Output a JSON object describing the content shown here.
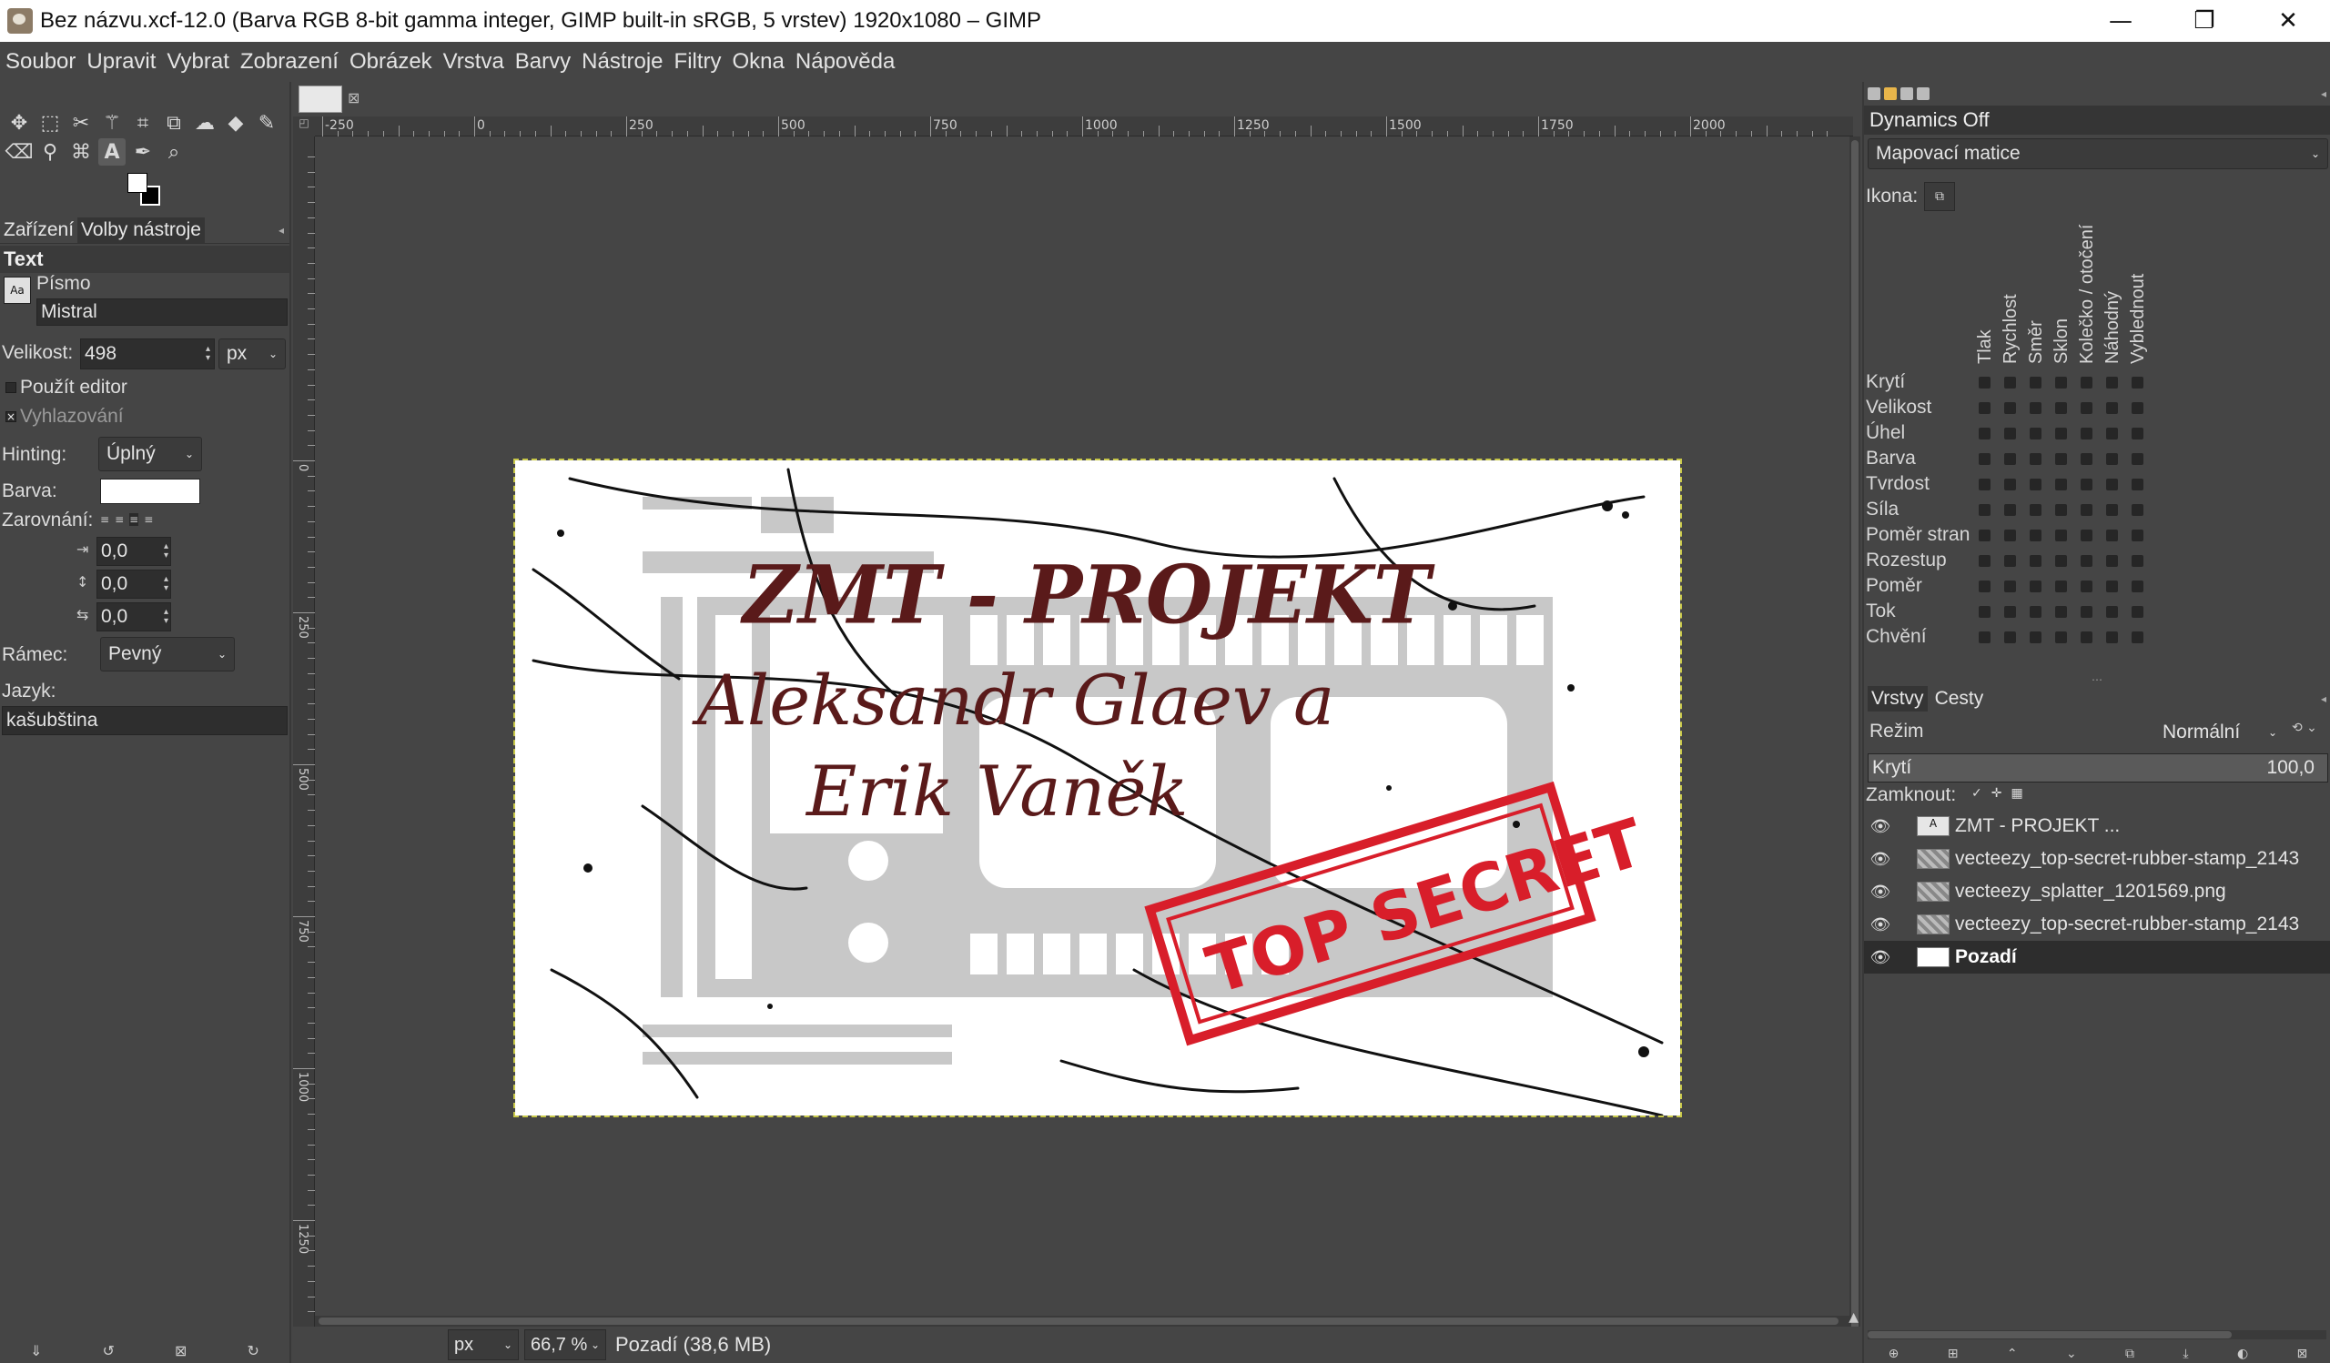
{
  "window": {
    "title": "Bez názvu.xcf-12.0 (Barva RGB 8-bit gamma integer, GIMP built-in sRGB, 5 vrstev) 1920x1080 – GIMP",
    "minimize": "—",
    "maximize": "❐",
    "close": "✕"
  },
  "menubar": [
    "Soubor",
    "Upravit",
    "Vybrat",
    "Zobrazení",
    "Obrázek",
    "Vrstva",
    "Barvy",
    "Nástroje",
    "Filtry",
    "Okna",
    "Nápověda"
  ],
  "toolbox": {
    "row1_icons": [
      "move-icon",
      "rect-select-icon",
      "free-select-icon",
      "fuzzy-select-icon",
      "crop-icon",
      "transform-icon",
      "warp-icon",
      "bucket-fill-icon",
      "paintbrush-icon"
    ],
    "row2_icons": [
      "eraser-icon",
      "clone-icon",
      "paths-icon",
      "text-icon",
      "color-picker-icon",
      "zoom-icon"
    ],
    "tabs": {
      "devices": "Zařízení",
      "tool_options": "Volby nástroje"
    },
    "section_title": "Text",
    "font_label": "Písmo",
    "font_value": "Mistral",
    "size_label": "Velikost:",
    "size_value": "498",
    "size_unit": "px",
    "use_editor": "Použít editor",
    "antialias": "Vyhlazování",
    "hinting_label": "Hinting:",
    "hinting_value": "Úplný",
    "color_label": "Barva:",
    "justify_label": "Zarovnání:",
    "indent_value": "0,0",
    "line_spacing_value": "0,0",
    "letter_spacing_value": "0,0",
    "box_label": "Rámec:",
    "box_value": "Pevný",
    "language_label": "Jazyk:",
    "language_value": "kašubština"
  },
  "canvas": {
    "ruler_top_labels": [
      "-250",
      "0",
      "250",
      "500",
      "750",
      "1000",
      "1250",
      "1500",
      "1750",
      "2000"
    ],
    "ruler_left_labels": [
      "0",
      "250",
      "500",
      "750",
      "1000",
      "1250"
    ],
    "image_texts": {
      "title": "ZMT - PROJEKT",
      "line2": "Aleksandr Glaev a",
      "line3": "Erik Vaněk",
      "stamp": "TOP SECRET"
    }
  },
  "status": {
    "unit": "px",
    "zoom": "66,7 %",
    "info": "Pozadí (38,6 MB)"
  },
  "dynamics": {
    "title": "Dynamics Off",
    "mapping": "Mapovací matice",
    "icon_label": "Ikona:",
    "columns": [
      "Tlak",
      "Rychlost",
      "Směr",
      "Sklon",
      "Kolečko / otočení",
      "Náhodný",
      "Vyblednout"
    ],
    "rows": [
      "Krytí",
      "Velikost",
      "Úhel",
      "Barva",
      "Tvrdost",
      "Síla",
      "Poměr stran",
      "Rozestup",
      "Poměr",
      "Tok",
      "Chvění"
    ]
  },
  "layers_panel": {
    "tabs": {
      "layers": "Vrstvy",
      "paths": "Cesty"
    },
    "mode_label": "Režim",
    "mode_value": "Normální",
    "opacity_label": "Krytí",
    "opacity_value": "100,0",
    "lock_label": "Zamknout:",
    "layers": [
      {
        "name": "ZMT - PROJEKT ...",
        "type": "text",
        "selected": false
      },
      {
        "name": "vecteezy_top-secret-rubber-stamp_2143",
        "type": "image",
        "selected": false
      },
      {
        "name": "vecteezy_splatter_1201569.png",
        "type": "image",
        "selected": false
      },
      {
        "name": "vecteezy_top-secret-rubber-stamp_2143",
        "type": "image",
        "selected": false
      },
      {
        "name": "Pozadí",
        "type": "background",
        "selected": true
      }
    ]
  },
  "colors": {
    "ui_bg": "#454545",
    "text_dark_red": "#5a1a1a",
    "stamp_red": "#d81e2a",
    "film_gray": "#c8c8c8"
  }
}
